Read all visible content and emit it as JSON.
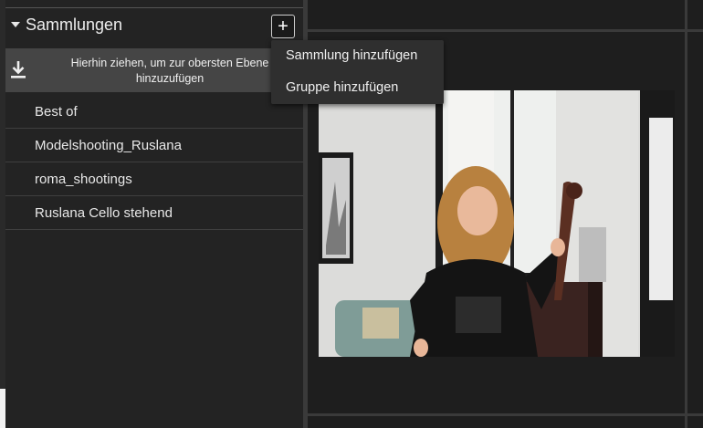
{
  "collections_panel": {
    "title": "Sammlungen",
    "add_button_label": "+",
    "drop_zone_text_line1": "Hierhin ziehen, um zur obersten Ebene",
    "drop_zone_text_line2": "hinzuzufügen",
    "items": [
      {
        "label": "Best of"
      },
      {
        "label": "Modelshooting_Ruslana"
      },
      {
        "label": "roma_shootings"
      },
      {
        "label": "Ruslana Cello stehend"
      }
    ]
  },
  "add_menu": {
    "items": [
      {
        "label": "Sammlung hinzufügen"
      },
      {
        "label": "Gruppe hinzufügen"
      }
    ]
  },
  "preview": {
    "icon": "photo-thumbnail"
  },
  "colors": {
    "panel_bg": "#232323",
    "drop_zone_bg": "#454545",
    "menu_bg": "#2f2f2f",
    "grid_line": "#3a3a3a"
  }
}
